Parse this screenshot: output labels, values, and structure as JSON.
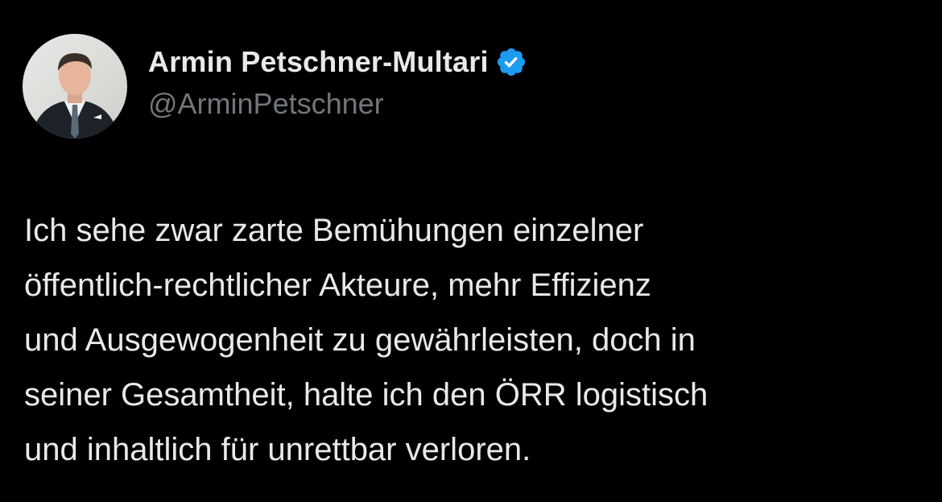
{
  "author": {
    "display_name": "Armin Petschner-Multari",
    "handle": "@ArminPetschner",
    "verified": true,
    "verified_icon": "verified-badge-icon",
    "avatar_icon": "profile-photo"
  },
  "tweet": {
    "lines": [
      "Ich sehe zwar zarte Bemühungen einzelner",
      "öffentlich-rechtlicher Akteure, mehr Effizienz",
      "und Ausgewogenheit zu gewährleisten, doch in",
      "seiner Gesamtheit, halte ich den ÖRR logistisch",
      "und inhaltlich für unrettbar verloren."
    ]
  },
  "colors": {
    "background": "#000000",
    "text_primary": "#e7e9ea",
    "text_secondary": "#71767b",
    "verified_blue": "#1d9bf0"
  }
}
